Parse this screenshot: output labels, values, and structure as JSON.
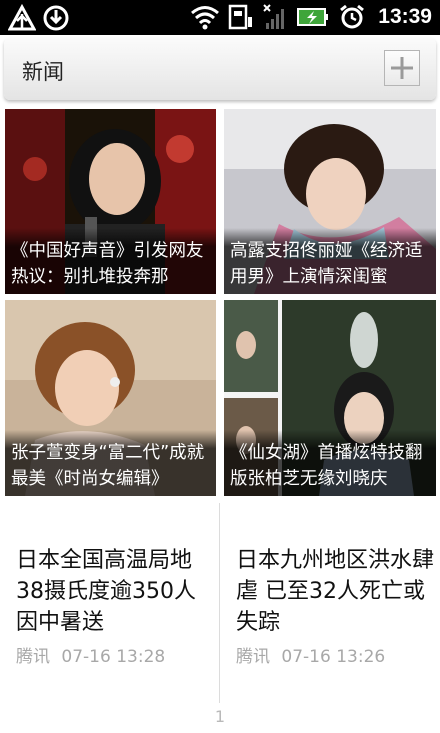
{
  "status_bar": {
    "time": "13:39",
    "icons": [
      "usb-debug-icon",
      "download-icon",
      "wifi-icon",
      "sim-icon",
      "signal-icon",
      "battery-charging-icon",
      "alarm-icon"
    ]
  },
  "header": {
    "title": "新闻",
    "add_icon": "plus-icon"
  },
  "tiles": [
    {
      "caption": "《中国好声音》引发网友热议：别扎堆投奔那"
    },
    {
      "caption": "高露支招佟丽娅《经济适用男》上演情深闺蜜"
    },
    {
      "caption": "张子萱变身“富二代”成就最美《时尚女编辑》"
    },
    {
      "caption": "《仙女湖》首播炫特技翻版张柏芝无缘刘晓庆"
    }
  ],
  "articles": [
    {
      "title": "日本全国高温局地38摄氏度逾350人因中暑送",
      "source": "腾讯",
      "time": "07-16 13:28"
    },
    {
      "title": "日本九州地区洪水肆虐 已至32人死亡或失踪",
      "source": "腾讯",
      "time": "07-16 13:26"
    }
  ],
  "pager": {
    "page": "1"
  }
}
